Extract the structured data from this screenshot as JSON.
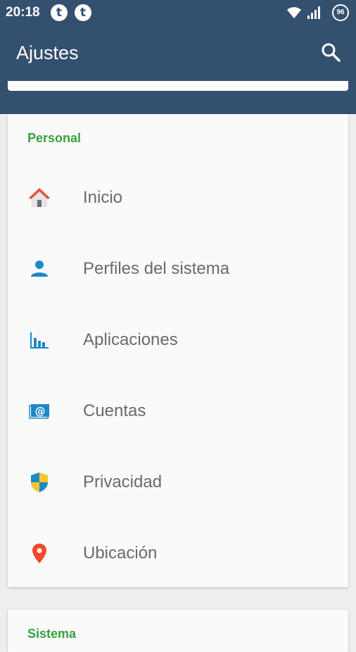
{
  "status_bar": {
    "time": "20:18",
    "notification_icons": [
      "t",
      "t"
    ],
    "battery": "96"
  },
  "app_bar": {
    "title": "Ajustes",
    "search_icon": "search-icon"
  },
  "sections": [
    {
      "title": "Personal",
      "items": [
        {
          "label": "Inicio",
          "icon": "home-icon"
        },
        {
          "label": "Perfiles del sistema",
          "icon": "person-icon"
        },
        {
          "label": "Aplicaciones",
          "icon": "bar-chart-icon"
        },
        {
          "label": "Cuentas",
          "icon": "at-sign-icon"
        },
        {
          "label": "Privacidad",
          "icon": "shield-icon"
        },
        {
          "label": "Ubicación",
          "icon": "location-pin-icon"
        }
      ]
    },
    {
      "title": "Sistema"
    }
  ],
  "colors": {
    "header": "#34506f",
    "section_title": "#3aa240",
    "item_text": "#6a6a6a",
    "icon_blue": "#1e88c8",
    "location_red": "#f0492b"
  }
}
